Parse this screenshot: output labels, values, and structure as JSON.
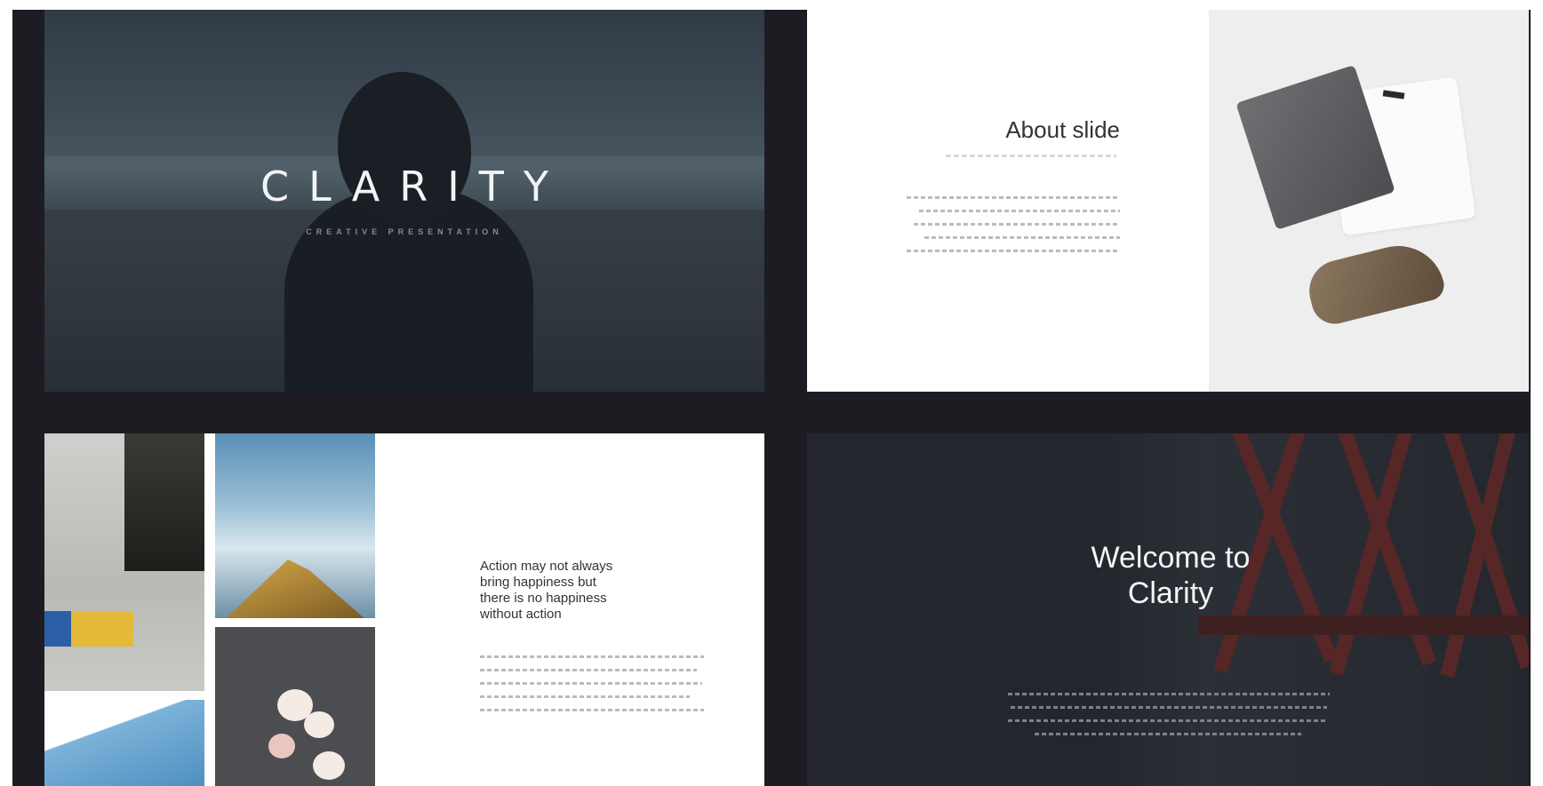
{
  "slides": {
    "clarity": {
      "title": "CLARITY",
      "subtitle": "CREATIVE PRESENTATION"
    },
    "about": {
      "title": "About slide"
    },
    "quote": {
      "line1": "Action may not always",
      "line2": "bring happiness but",
      "line3": "there is no happiness",
      "line4": "without action"
    },
    "welcome": {
      "line1": "Welcome to",
      "line2": "Clarity"
    }
  },
  "colors": {
    "background": "#1c1c22",
    "slide_text_dark": "#2f3438",
    "slide_text_light": "#f4f4f4",
    "bridge_red": "#8a2f2b"
  }
}
